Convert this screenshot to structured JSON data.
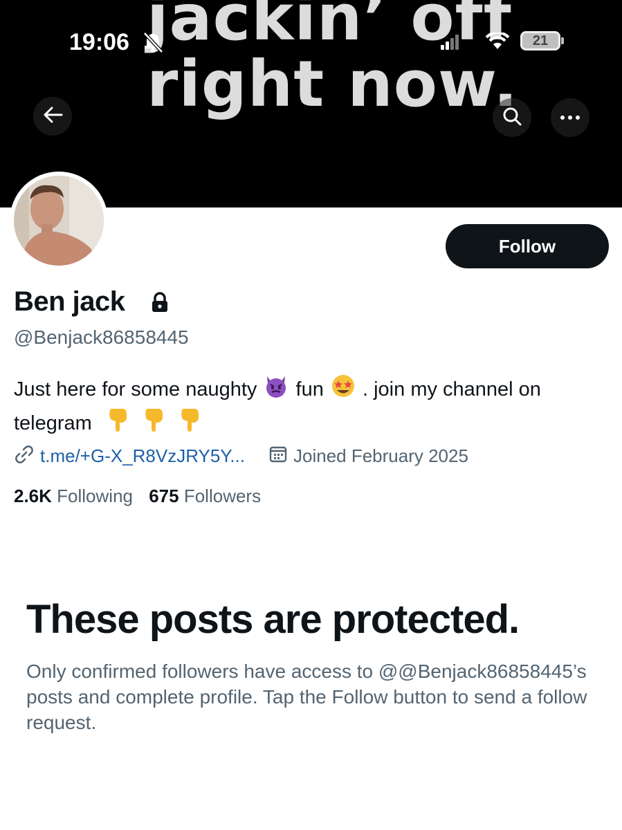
{
  "status_bar": {
    "time": "19:06",
    "battery_level": "21"
  },
  "banner": {
    "line1": "jackin’ off",
    "line2": "right now."
  },
  "header": {
    "back_icon": "arrow-left-icon",
    "search_icon": "search-icon",
    "more_icon": "more-horizontal-icon"
  },
  "profile": {
    "name": "Ben jack",
    "handle": "@Benjack86858445",
    "follow_label": "Follow",
    "bio_part1": "Just here for some naughty",
    "bio_part2": "fun",
    "bio_part3": ". join my channel on telegram",
    "bio_emojis": [
      "smiling-imp",
      "star-struck",
      "backhand-index-pointing-down",
      "backhand-index-pointing-down",
      "backhand-index-pointing-down"
    ],
    "link": "t.me/+G-X_R8VzJRY5Y...",
    "joined": "Joined February 2025",
    "following_count": "2.6K",
    "following_label": "Following",
    "followers_count": "675",
    "followers_label": "Followers"
  },
  "protected": {
    "title": "These posts are protected.",
    "body": "Only confirmed followers have access to @@Benjack86858445’s posts and complete profile. Tap the Follow button to send a follow request."
  },
  "colors": {
    "text_primary": "#0f1419",
    "text_secondary": "#536471",
    "link": "#1d5fa8",
    "button_bg": "#0f1419"
  }
}
